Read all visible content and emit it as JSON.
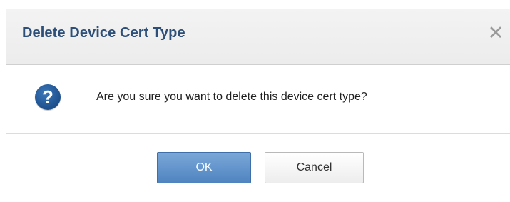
{
  "dialog": {
    "title": "Delete Device Cert Type",
    "close_glyph": "✕",
    "icon": "question-circle-icon",
    "icon_glyph": "?",
    "message": "Are you sure you want to delete this device cert type?",
    "buttons": {
      "ok_label": "OK",
      "cancel_label": "Cancel"
    }
  },
  "colors": {
    "title": "#2d4f7a",
    "primary_button": "#5a8ec8",
    "icon": "#1d4f8c"
  }
}
